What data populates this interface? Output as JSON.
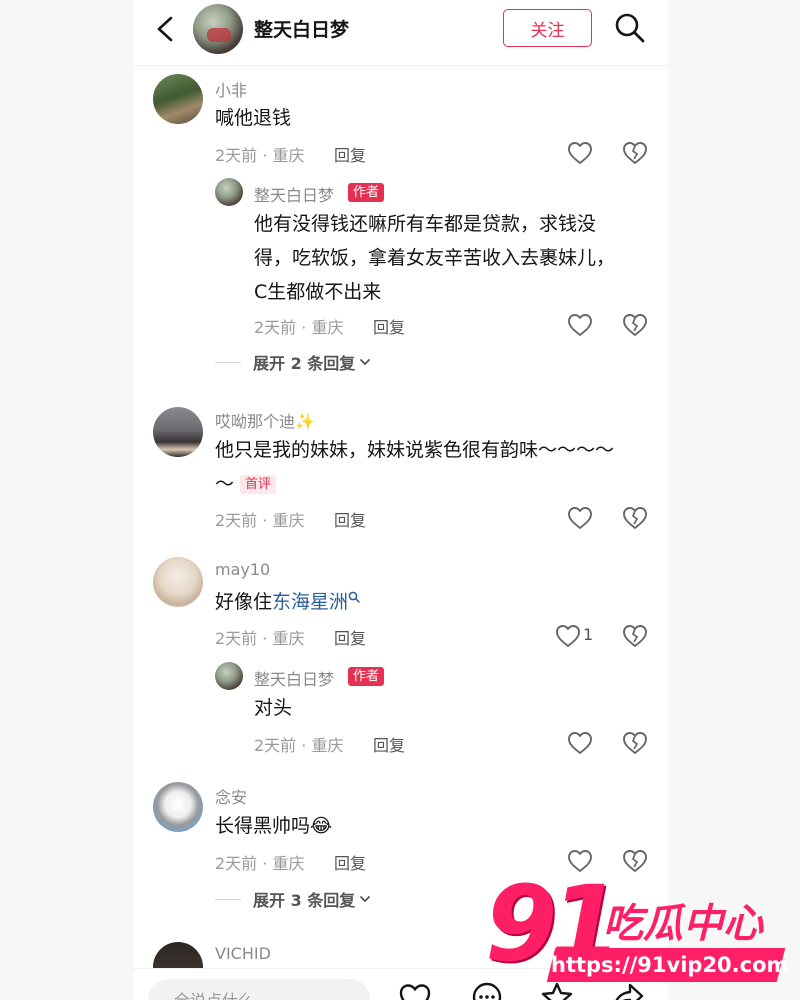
{
  "header": {
    "title": "整天白日梦",
    "follow_label": "关注"
  },
  "comments": [
    {
      "user": "小非",
      "text": "喊他退钱",
      "meta": "2天前 · 重庆",
      "reply_label": "回复",
      "replies": [
        {
          "user": "整天白日梦",
          "tag": "作者",
          "text_lines": [
            "他有没得钱还嘛所有车都是贷款，求钱没",
            "得，吃软饭，拿着女友辛苦收入去裹妹儿，",
            "C生都做不出来"
          ],
          "meta": "2天前 · 重庆",
          "reply_label": "回复"
        }
      ],
      "expand_label": "展开 2 条回复"
    },
    {
      "user": "哎呦那个迪✨",
      "text_line1": "他只是我的妹妹，妹妹说紫色很有韵味～～～～",
      "text_line2": "～",
      "tag": "首评",
      "meta": "2天前 · 重庆",
      "reply_label": "回复"
    },
    {
      "user": "may10",
      "text_prefix": "好像住",
      "text_link": "东海星洲",
      "meta": "2天前 · 重庆",
      "reply_label": "回复",
      "like_count": "1",
      "replies": [
        {
          "user": "整天白日梦",
          "tag": "作者",
          "text": "对头",
          "meta": "2天前 · 重庆",
          "reply_label": "回复"
        }
      ]
    },
    {
      "user": "念安",
      "text": "长得黑帅吗😂",
      "meta": "2天前 · 重庆",
      "reply_label": "回复",
      "expand_label": "展开 3 条回复"
    },
    {
      "user": "VICHID"
    }
  ],
  "bottom": {
    "input_placeholder": "全说点什么"
  },
  "watermark": {
    "number": "91",
    "text": "吃瓜中心",
    "url": "https://91vip20.com"
  },
  "icons": {
    "back": "chevron-left-icon",
    "search": "search-icon",
    "like": "heart-icon",
    "dislike": "broken-heart-icon"
  },
  "colors": {
    "accent": "#e63052",
    "link": "#2c5e9c",
    "watermark": "#ff1f66"
  }
}
